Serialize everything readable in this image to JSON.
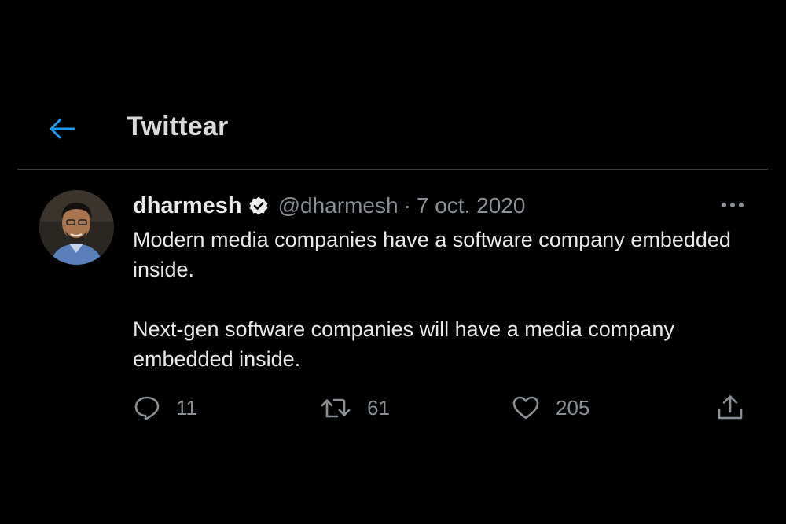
{
  "header": {
    "title": "Twittear",
    "back_icon": "arrow-left-icon",
    "accent_color": "#1d9bf0"
  },
  "tweet": {
    "author_name": "dharmesh",
    "verified": true,
    "handle": "@dharmesh",
    "separator": "·",
    "date": "7 oct. 2020",
    "paragraphs": [
      "Modern media companies have a software company embedded inside.",
      "Next-gen software companies will have a media company embedded inside."
    ],
    "actions": {
      "reply_count": "11",
      "retweet_count": "61",
      "like_count": "205"
    }
  },
  "colors": {
    "background": "#000000",
    "text_primary": "#e7e9ea",
    "text_secondary": "#8b9096",
    "divider": "#3a3d40"
  }
}
